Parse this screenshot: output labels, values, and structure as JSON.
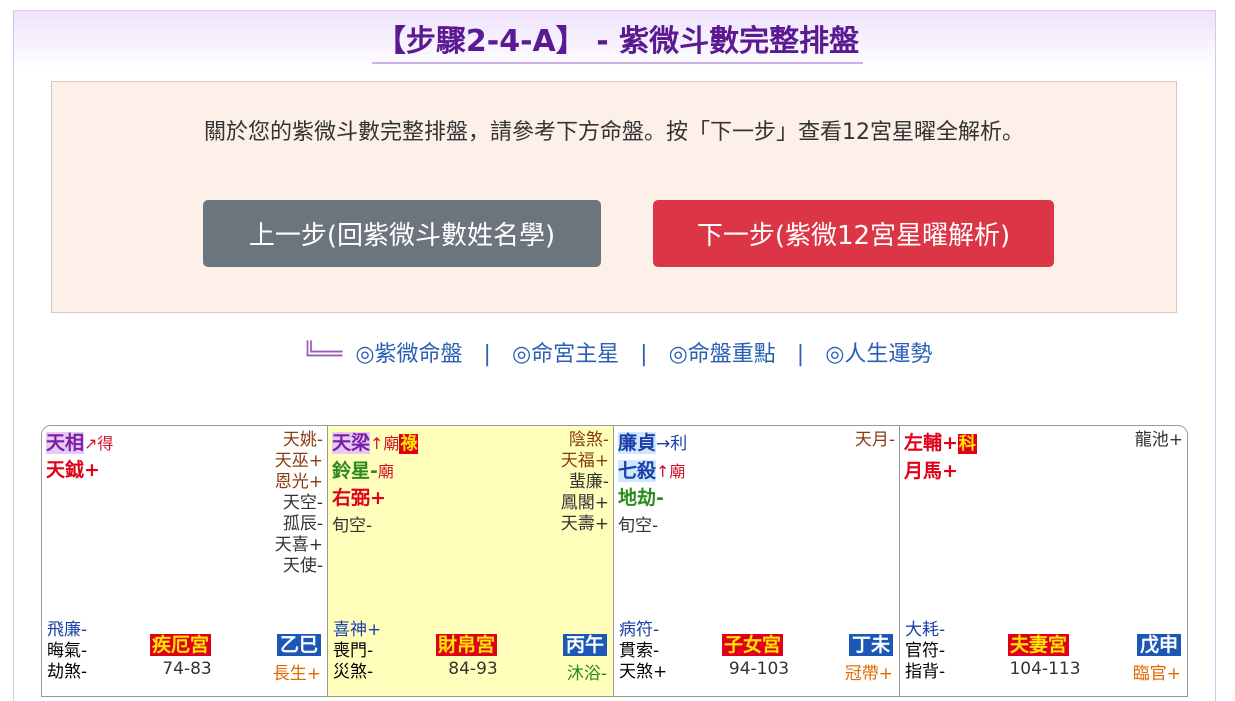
{
  "page": {
    "title": "【步驟2-4-A】 - 紫微斗數完整排盤",
    "notice": "關於您的紫微斗數完整排盤，請參考下方命盤。按「下一步」查看12宮星曜全解析。",
    "prev_button": "上一步(回紫微斗數姓名學)",
    "next_button": "下一步(紫微12宮星曜解析)"
  },
  "nav": {
    "corner_icon": "╚══",
    "links": [
      "◎紫微命盤",
      "◎命宮主星",
      "◎命盤重點",
      "◎人生運勢"
    ],
    "separator": "|"
  },
  "chart": {
    "palaces": [
      {
        "main": [
          {
            "name": "天相",
            "style": "purple",
            "suffix": "↗得",
            "suffix_style": "red-arrow"
          },
          {
            "name": "天鉞+",
            "style": "red"
          }
        ],
        "minor": [
          "天姚-",
          "天巫+",
          "恩光+",
          "天空-",
          "孤辰-",
          "天喜+",
          "天使-"
        ],
        "minor_colors": [
          "brown",
          "brown",
          "brown",
          "dark",
          "dark",
          "dark",
          "dark"
        ],
        "bottom_left": [
          "飛廉-",
          "晦氣-",
          "劫煞-"
        ],
        "palace_name": "疾厄宮",
        "range": "74-83",
        "ganzhi": "乙巳",
        "life_stage": "長生+",
        "highlight": false
      },
      {
        "main": [
          {
            "name": "天梁",
            "style": "purple",
            "suffix": "↑廟",
            "hua": "祿"
          },
          {
            "name": "鈴星-",
            "style": "green",
            "suffix": "廟"
          },
          {
            "name": "右弼+",
            "style": "red"
          },
          {
            "name": "旬空-",
            "style": "plain"
          }
        ],
        "minor": [
          "陰煞-",
          "天福+",
          "蜚廉-",
          "鳳閣+",
          "天壽+"
        ],
        "minor_colors": [
          "brown",
          "brown",
          "dark",
          "dark",
          "dark"
        ],
        "bottom_left": [
          "喜神+",
          "喪門-",
          "災煞-"
        ],
        "palace_name": "財帛宮",
        "range": "84-93",
        "ganzhi": "丙午",
        "life_stage": "沐浴-",
        "highlight": true
      },
      {
        "main": [
          {
            "name": "廉貞",
            "style": "blue",
            "suffix": "→利",
            "suffix_style": "blue-arrow"
          },
          {
            "name": "七殺",
            "style": "blue",
            "suffix": "↑廟"
          },
          {
            "name": "地劫-",
            "style": "green"
          },
          {
            "name": "旬空-",
            "style": "plain"
          }
        ],
        "minor": [
          "天月-"
        ],
        "minor_colors": [
          "brown"
        ],
        "bottom_left": [
          "病符-",
          "貫索-",
          "天煞+"
        ],
        "palace_name": "子女宮",
        "range": "94-103",
        "ganzhi": "丁未",
        "life_stage": "冠帶+",
        "highlight": false
      },
      {
        "main": [
          {
            "name": "左輔+",
            "style": "red",
            "hua": "科"
          },
          {
            "name": "月馬+",
            "style": "red"
          }
        ],
        "minor": [
          "龍池+"
        ],
        "minor_colors": [
          "dark"
        ],
        "bottom_left": [
          "大耗-",
          "官符-",
          "指背-"
        ],
        "palace_name": "夫妻宮",
        "range": "104-113",
        "ganzhi": "戊申",
        "life_stage": "臨官+",
        "highlight": false
      }
    ]
  }
}
